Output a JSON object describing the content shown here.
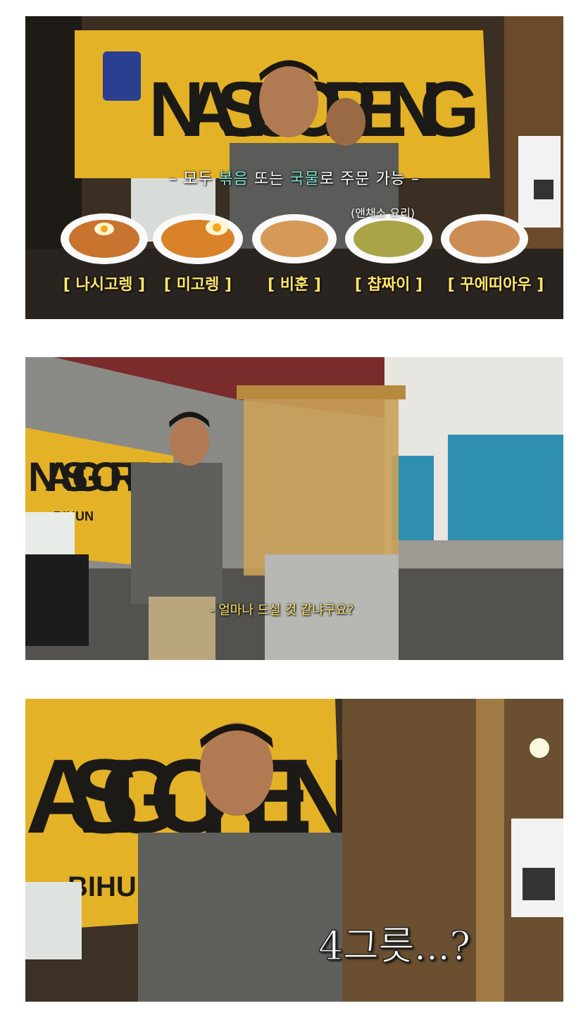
{
  "panel1": {
    "title_prefix": "– 모두 ",
    "title_highlight1": "볶음",
    "title_middle": " 또는 ",
    "title_highlight2": "국물",
    "title_suffix": "로 주문 가능 –",
    "banner_text": "NASI GORENG",
    "veg_note": "(앤채소 요리)",
    "dishes": [
      {
        "label": "[ 나시고렝 ]"
      },
      {
        "label": "[ 미고렝 ]"
      },
      {
        "label": "[ 비훈 ]"
      },
      {
        "label": "[ 챱짜이 ]"
      },
      {
        "label": "[ 꾸에띠아우 ]"
      }
    ]
  },
  "panel2": {
    "banner_text": "NASI GOREN",
    "banner_sub": "BIHUN",
    "subtitle": "- 얼마나 드실 것 같냐구요?"
  },
  "panel3": {
    "banner_text": "ASI GOREN",
    "banner_sub": "BIHUN",
    "caption": "4그릇...?"
  },
  "colors": {
    "caption_yellow": "#ffe66b",
    "caption_teal": "#7fe3d0",
    "banner_yellow": "#e9b62a",
    "banner_text": "#1c1a17"
  }
}
